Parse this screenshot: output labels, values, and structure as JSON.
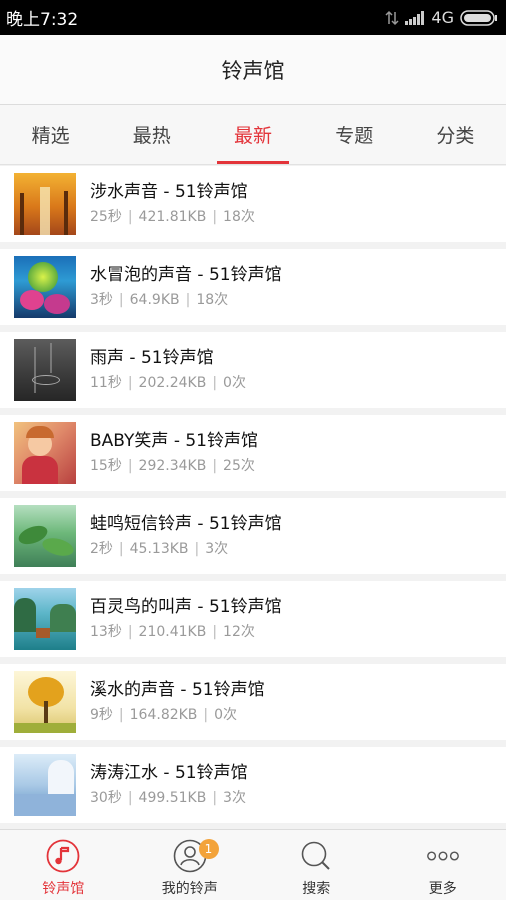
{
  "status_bar": {
    "time": "晚上7:32",
    "network": "4G"
  },
  "header": {
    "title": "铃声馆"
  },
  "tabs": [
    {
      "label": "精选",
      "active": false
    },
    {
      "label": "最热",
      "active": false
    },
    {
      "label": "最新",
      "active": true
    },
    {
      "label": "专题",
      "active": false
    },
    {
      "label": "分类",
      "active": false
    }
  ],
  "ringtones": [
    {
      "title": "涉水声音 - 51铃声馆",
      "duration": "25秒",
      "size": "421.81KB",
      "plays": "18次"
    },
    {
      "title": "水冒泡的声音 - 51铃声馆",
      "duration": "3秒",
      "size": "64.9KB",
      "plays": "18次"
    },
    {
      "title": "雨声 - 51铃声馆",
      "duration": "11秒",
      "size": "202.24KB",
      "plays": "0次"
    },
    {
      "title": "BABY笑声 - 51铃声馆",
      "duration": "15秒",
      "size": "292.34KB",
      "plays": "25次"
    },
    {
      "title": "蛙鸣短信铃声 - 51铃声馆",
      "duration": "2秒",
      "size": "45.13KB",
      "plays": "3次"
    },
    {
      "title": "百灵鸟的叫声 - 51铃声馆",
      "duration": "13秒",
      "size": "210.41KB",
      "plays": "12次"
    },
    {
      "title": "溪水的声音 - 51铃声馆",
      "duration": "9秒",
      "size": "164.82KB",
      "plays": "0次"
    },
    {
      "title": "涛涛江水 - 51铃声馆",
      "duration": "30秒",
      "size": "499.51KB",
      "plays": "3次"
    }
  ],
  "bottom_nav": [
    {
      "label": "铃声馆",
      "icon": "music-note-icon",
      "active": true
    },
    {
      "label": "我的铃声",
      "icon": "user-icon",
      "active": false,
      "badge": "1"
    },
    {
      "label": "搜索",
      "icon": "search-icon",
      "active": false
    },
    {
      "label": "更多",
      "icon": "more-icon",
      "active": false
    }
  ],
  "colors": {
    "accent": "#e3343a",
    "badge": "#f3a33a",
    "status_bar": "#000000"
  }
}
